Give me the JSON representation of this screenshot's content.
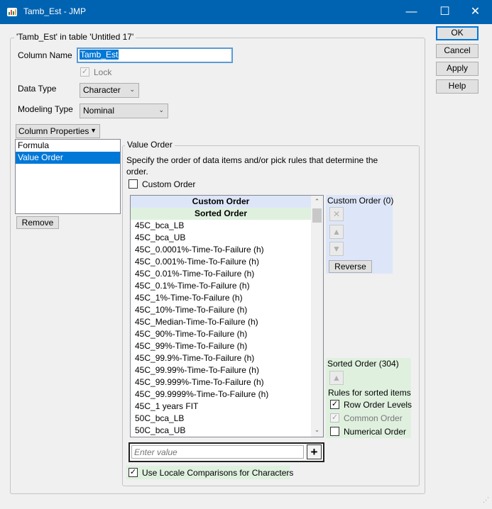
{
  "window": {
    "title": "Tamb_Est - JMP",
    "controls": {
      "minimize": "—",
      "maximize": "☐",
      "close": "✕"
    }
  },
  "group_title": "'Tamb_Est' in table 'Untitled 17'",
  "column_name": {
    "label": "Column Name",
    "value": "Tamb_Est"
  },
  "lock": {
    "label": "Lock",
    "checked": true
  },
  "data_type": {
    "label": "Data Type",
    "value": "Character"
  },
  "modeling_type": {
    "label": "Modeling Type",
    "value": "Nominal"
  },
  "column_properties": {
    "button": "Column Properties",
    "items": [
      "Formula",
      "Value Order"
    ],
    "selected": "Value Order",
    "remove": "Remove"
  },
  "value_order": {
    "title": "Value Order",
    "description": "Specify the order of data items and/or pick rules that determine the order.",
    "custom_order_checkbox": "Custom Order",
    "list_headers": {
      "custom": "Custom Order",
      "sorted": "Sorted Order"
    },
    "items": [
      "45C_bca_LB",
      "45C_bca_UB",
      "45C_0.0001%-Time-To-Failure (h)",
      "45C_0.001%-Time-To-Failure (h)",
      "45C_0.01%-Time-To-Failure (h)",
      "45C_0.1%-Time-To-Failure (h)",
      "45C_1%-Time-To-Failure (h)",
      "45C_10%-Time-To-Failure (h)",
      "45C_Median-Time-To-Failure (h)",
      "45C_90%-Time-To-Failure (h)",
      "45C_99%-Time-To-Failure (h)",
      "45C_99.9%-Time-To-Failure (h)",
      "45C_99.99%-Time-To-Failure (h)",
      "45C_99.999%-Time-To-Failure (h)",
      "45C_99.9999%-Time-To-Failure (h)",
      "45C_1 years FIT",
      "50C_bca_LB",
      "50C_bca_UB"
    ],
    "custom_order_panel": {
      "title": "Custom Order (0)",
      "reverse": "Reverse"
    },
    "sorted_order_panel": {
      "title": "Sorted Order (304)",
      "rules_label": "Rules for sorted items",
      "rules": [
        {
          "label": "Row Order Levels",
          "checked": true,
          "enabled": true
        },
        {
          "label": "Common Order",
          "checked": true,
          "enabled": false
        },
        {
          "label": "Numerical Order",
          "checked": false,
          "enabled": true
        }
      ]
    },
    "enter_value_placeholder": "Enter value",
    "add_button": "+",
    "locale_checkbox": {
      "label": "Use Locale Comparisons for Characters",
      "checked": true
    }
  },
  "buttons": {
    "ok": "OK",
    "cancel": "Cancel",
    "apply": "Apply",
    "help": "Help"
  },
  "icons": {
    "app": "jmp-app-icon",
    "delete": "x-icon",
    "up": "up-arrow-icon",
    "down": "down-arrow-icon",
    "add": "plus-icon"
  },
  "colors": {
    "titlebar": "#0063b1",
    "selection": "#0078d7",
    "custom_panel": "#dde6f8",
    "sorted_panel": "#dff0df"
  }
}
